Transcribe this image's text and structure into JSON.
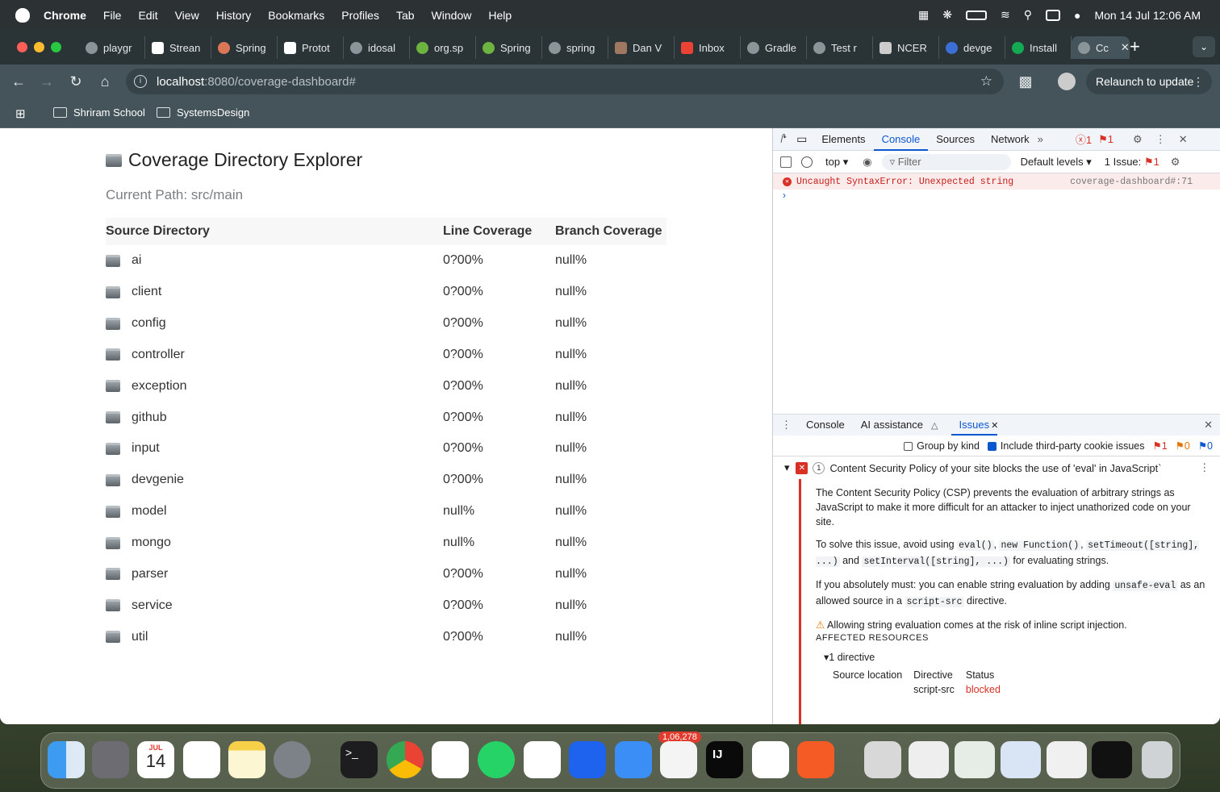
{
  "menubar": {
    "app": "Chrome",
    "items": [
      "File",
      "Edit",
      "View",
      "History",
      "Bookmarks",
      "Profiles",
      "Tab",
      "Window",
      "Help"
    ],
    "clock": "Mon 14 Jul  12:06 AM"
  },
  "tabs": [
    {
      "title": "playgr"
    },
    {
      "title": "Strean"
    },
    {
      "title": "Spring"
    },
    {
      "title": "Protot"
    },
    {
      "title": "idosal"
    },
    {
      "title": "org.sp"
    },
    {
      "title": "Spring"
    },
    {
      "title": "spring"
    },
    {
      "title": "Dan V"
    },
    {
      "title": "Inbox"
    },
    {
      "title": "Gradle"
    },
    {
      "title": "Test r"
    },
    {
      "title": "NCER"
    },
    {
      "title": "devge"
    },
    {
      "title": "Install"
    },
    {
      "title": "Cc"
    }
  ],
  "address": {
    "host": "localhost",
    "rest": ":8080/coverage-dashboard#"
  },
  "relaunch": "Relaunch to update",
  "bookmarks": [
    "Shriram School",
    "SystemsDesign"
  ],
  "page": {
    "title": "Coverage Directory Explorer",
    "current_path": "Current Path: src/main",
    "headers": [
      "Source Directory",
      "Line Coverage",
      "Branch Coverage"
    ],
    "rows": [
      {
        "name": "ai",
        "line": "0?00%",
        "branch": "null%"
      },
      {
        "name": "client",
        "line": "0?00%",
        "branch": "null%"
      },
      {
        "name": "config",
        "line": "0?00%",
        "branch": "null%"
      },
      {
        "name": "controller",
        "line": "0?00%",
        "branch": "null%"
      },
      {
        "name": "exception",
        "line": "0?00%",
        "branch": "null%"
      },
      {
        "name": "github",
        "line": "0?00%",
        "branch": "null%"
      },
      {
        "name": "input",
        "line": "0?00%",
        "branch": "null%"
      },
      {
        "name": "devgenie",
        "line": "0?00%",
        "branch": "null%"
      },
      {
        "name": "model",
        "line": "null%",
        "branch": "null%"
      },
      {
        "name": "mongo",
        "line": "null%",
        "branch": "null%"
      },
      {
        "name": "parser",
        "line": "0?00%",
        "branch": "null%"
      },
      {
        "name": "service",
        "line": "0?00%",
        "branch": "null%"
      },
      {
        "name": "util",
        "line": "0?00%",
        "branch": "null%"
      }
    ]
  },
  "devtools": {
    "tabs": [
      "Elements",
      "Console",
      "Sources",
      "Network"
    ],
    "err_count": "1",
    "issue_count": "1",
    "context": "top",
    "filter": "Filter",
    "levels": "Default levels",
    "issues_label": "1 Issue:",
    "issues_n": "1",
    "error": "Uncaught SyntaxError: Unexpected string",
    "error_src": "coverage-dashboard#:71",
    "drawer_tabs": [
      "Console",
      "AI assistance",
      "Issues"
    ],
    "group_by": "Group by kind",
    "third_party": "Include third-party cookie issues",
    "counts": [
      "1",
      "0",
      "0"
    ],
    "issue": {
      "num": "1",
      "title": "Content Security Policy of your site blocks the use of 'eval' in JavaScript`",
      "p1": "The Content Security Policy (CSP) prevents the evaluation of arbitrary strings as JavaScript to make it more difficult for an attacker to inject unathorized code on your site.",
      "p2a": "To solve this issue, avoid using",
      "c1": "eval()",
      "c2": "new Function()",
      "c3": "setTimeout([string], ...)",
      "and": "and",
      "c4": "setInterval([string], ...)",
      "p2b": "for evaluating strings.",
      "p3a": "If you absolutely must: you can enable string evaluation by adding",
      "c5": "unsafe-eval",
      "p3b": "as an allowed source in a",
      "c6": "script-src",
      "p3c": "directive.",
      "warn": "Allowing string evaluation comes at the risk of inline script injection.",
      "affected": "AFFECTED RESOURCES",
      "directive_count": "1 directive",
      "cols": [
        "Source location",
        "Directive",
        "Status"
      ],
      "directive": "script-src",
      "status": "blocked"
    }
  },
  "dock": {
    "calendar_month": "JUL",
    "calendar_day": "14",
    "mail_badge": "1,06,278"
  }
}
